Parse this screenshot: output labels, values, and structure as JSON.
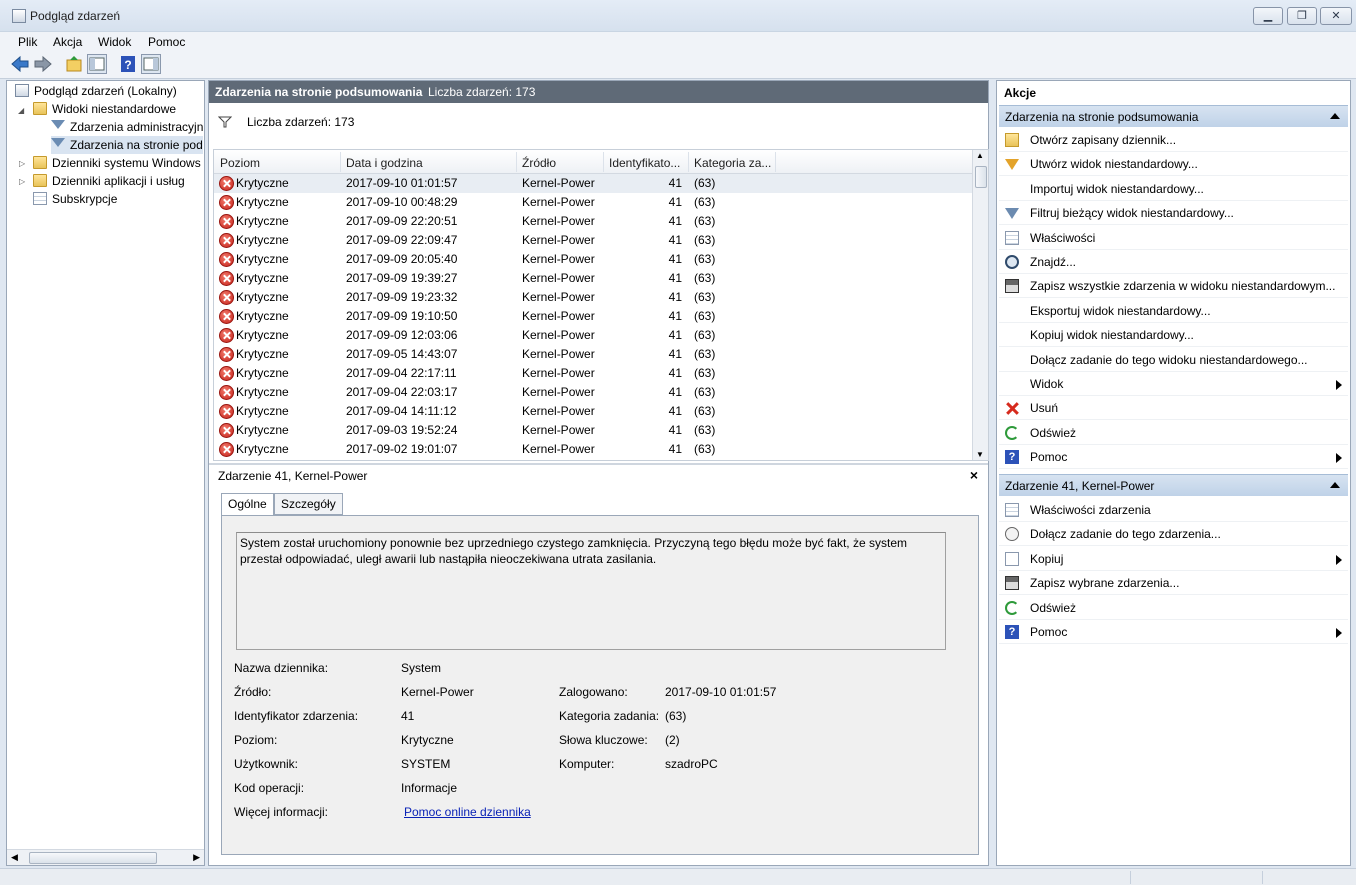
{
  "window": {
    "title": "Podgląd zdarzeń"
  },
  "menu": [
    "Plik",
    "Akcja",
    "Widok",
    "Pomoc"
  ],
  "tree": {
    "root": "Podgląd zdarzeń (Lokalny)",
    "custom_views": "Widoki niestandardowe",
    "admin_events": "Zdarzenia administracyjn",
    "summary_events": "Zdarzenia na stronie pod",
    "windows_logs": "Dzienniki systemu Windows",
    "app_logs": "Dzienniki aplikacji i usług",
    "subscriptions": "Subskrypcje"
  },
  "center": {
    "header_title": "Zdarzenia na stronie podsumowania",
    "header_count": "Liczba zdarzeń: 173",
    "filter_label": "Liczba zdarzeń: 173",
    "columns": [
      "Poziom",
      "Data i godzina",
      "Źródło",
      "Identyfikato...",
      "Kategoria za..."
    ],
    "rows": [
      {
        "level": "Krytyczne",
        "date": "2017-09-10 01:01:57",
        "source": "Kernel-Power",
        "id": "41",
        "cat": "(63)"
      },
      {
        "level": "Krytyczne",
        "date": "2017-09-10 00:48:29",
        "source": "Kernel-Power",
        "id": "41",
        "cat": "(63)"
      },
      {
        "level": "Krytyczne",
        "date": "2017-09-09 22:20:51",
        "source": "Kernel-Power",
        "id": "41",
        "cat": "(63)"
      },
      {
        "level": "Krytyczne",
        "date": "2017-09-09 22:09:47",
        "source": "Kernel-Power",
        "id": "41",
        "cat": "(63)"
      },
      {
        "level": "Krytyczne",
        "date": "2017-09-09 20:05:40",
        "source": "Kernel-Power",
        "id": "41",
        "cat": "(63)"
      },
      {
        "level": "Krytyczne",
        "date": "2017-09-09 19:39:27",
        "source": "Kernel-Power",
        "id": "41",
        "cat": "(63)"
      },
      {
        "level": "Krytyczne",
        "date": "2017-09-09 19:23:32",
        "source": "Kernel-Power",
        "id": "41",
        "cat": "(63)"
      },
      {
        "level": "Krytyczne",
        "date": "2017-09-09 19:10:50",
        "source": "Kernel-Power",
        "id": "41",
        "cat": "(63)"
      },
      {
        "level": "Krytyczne",
        "date": "2017-09-09 12:03:06",
        "source": "Kernel-Power",
        "id": "41",
        "cat": "(63)"
      },
      {
        "level": "Krytyczne",
        "date": "2017-09-05 14:43:07",
        "source": "Kernel-Power",
        "id": "41",
        "cat": "(63)"
      },
      {
        "level": "Krytyczne",
        "date": "2017-09-04 22:17:11",
        "source": "Kernel-Power",
        "id": "41",
        "cat": "(63)"
      },
      {
        "level": "Krytyczne",
        "date": "2017-09-04 22:03:17",
        "source": "Kernel-Power",
        "id": "41",
        "cat": "(63)"
      },
      {
        "level": "Krytyczne",
        "date": "2017-09-04 14:11:12",
        "source": "Kernel-Power",
        "id": "41",
        "cat": "(63)"
      },
      {
        "level": "Krytyczne",
        "date": "2017-09-03 19:52:24",
        "source": "Kernel-Power",
        "id": "41",
        "cat": "(63)"
      },
      {
        "level": "Krytyczne",
        "date": "2017-09-02 19:01:07",
        "source": "Kernel-Power",
        "id": "41",
        "cat": "(63)"
      }
    ]
  },
  "detail": {
    "title": "Zdarzenie 41, Kernel-Power",
    "close": "×",
    "tabs": [
      "Ogólne",
      "Szczegóły"
    ],
    "description": "System został uruchomiony ponownie bez uprzedniego czystego zamknięcia. Przyczyną tego błędu może być fakt, że system przestał odpowiadać, uległ awarii lub nastąpiła nieoczekiwana utrata zasilania.",
    "fields": {
      "log_name_label": "Nazwa dziennika:",
      "log_name": "System",
      "source_label": "Źródło:",
      "source": "Kernel-Power",
      "logged_label": "Zalogowano:",
      "logged": "2017-09-10 01:01:57",
      "event_id_label": "Identyfikator zdarzenia:",
      "event_id": "41",
      "task_cat_label": "Kategoria zadania:",
      "task_cat": "(63)",
      "level_label": "Poziom:",
      "level": "Krytyczne",
      "keywords_label": "Słowa kluczowe:",
      "keywords": "(2)",
      "user_label": "Użytkownik:",
      "user": "SYSTEM",
      "computer_label": "Komputer:",
      "computer": "szadroPC",
      "opcode_label": "Kod operacji:",
      "opcode": "Informacje",
      "more_info_label": "Więcej informacji:",
      "more_info_link": "Pomoc online dziennika"
    }
  },
  "actions": {
    "title": "Akcje",
    "section1": "Zdarzenia na stronie podsumowania",
    "items1": [
      {
        "label": "Otwórz zapisany dziennik...",
        "icon": "folder-open-icon"
      },
      {
        "label": "Utwórz widok niestandardowy...",
        "icon": "filter-icon"
      },
      {
        "label": "Importuj widok niestandardowy...",
        "icon": "none"
      },
      {
        "label": "Filtruj bieżący widok niestandardowy...",
        "icon": "filter-icon"
      },
      {
        "label": "Właściwości",
        "icon": "properties-icon"
      },
      {
        "label": "Znajdź...",
        "icon": "binoculars-icon"
      },
      {
        "label": "Zapisz wszystkie zdarzenia w widoku niestandardowym...",
        "icon": "save-icon"
      },
      {
        "label": "Eksportuj widok niestandardowy...",
        "icon": "none"
      },
      {
        "label": "Kopiuj widok niestandardowy...",
        "icon": "none"
      },
      {
        "label": "Dołącz zadanie do tego widoku niestandardowego...",
        "icon": "none"
      },
      {
        "label": "Widok",
        "icon": "none",
        "submenu": true
      },
      {
        "label": "Usuń",
        "icon": "delete-icon"
      },
      {
        "label": "Odśwież",
        "icon": "refresh-icon"
      },
      {
        "label": "Pomoc",
        "icon": "help-icon",
        "submenu": true
      }
    ],
    "section2": "Zdarzenie 41, Kernel-Power",
    "items2": [
      {
        "label": "Właściwości zdarzenia",
        "icon": "properties-icon"
      },
      {
        "label": "Dołącz zadanie do tego zdarzenia...",
        "icon": "task-clock-icon"
      },
      {
        "label": "Kopiuj",
        "icon": "copy-icon",
        "submenu": true
      },
      {
        "label": "Zapisz wybrane zdarzenia...",
        "icon": "save-icon"
      },
      {
        "label": "Odśwież",
        "icon": "refresh-icon"
      },
      {
        "label": "Pomoc",
        "icon": "help-icon",
        "submenu": true
      }
    ]
  }
}
